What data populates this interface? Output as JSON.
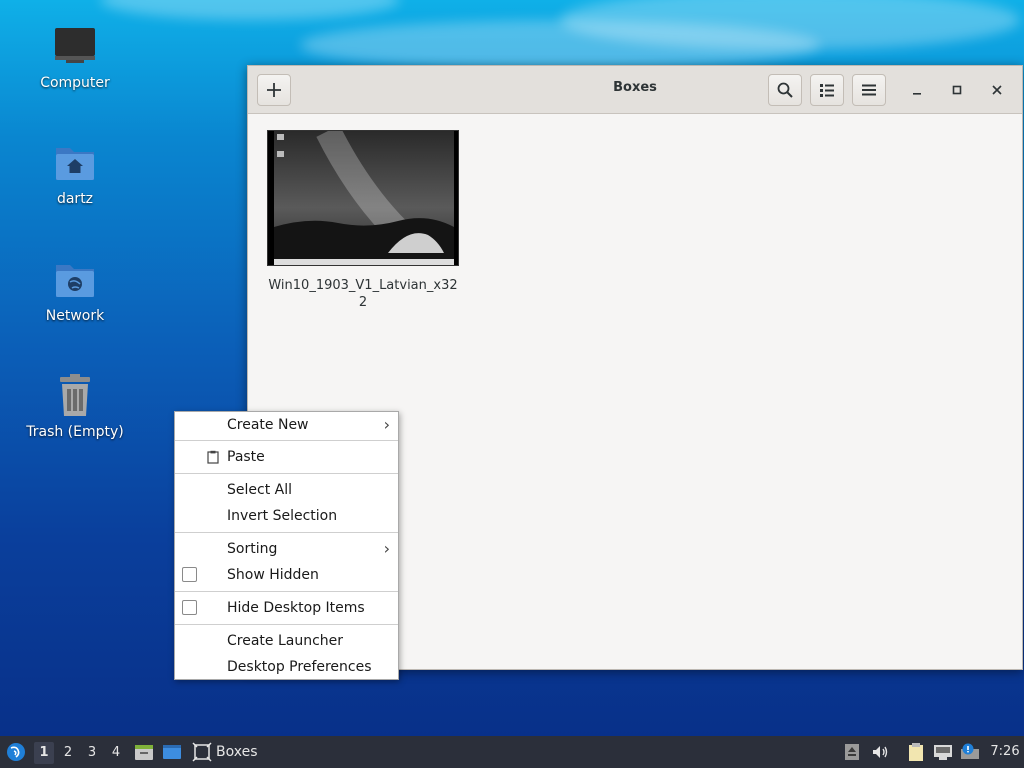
{
  "desktop": {
    "icons": [
      {
        "label": "Computer"
      },
      {
        "label": "dartz"
      },
      {
        "label": "Network"
      },
      {
        "label": "Trash (Empty)"
      }
    ]
  },
  "window": {
    "title": "Boxes",
    "vm": {
      "name": "Win10_1903_V1_Latvian_x322"
    }
  },
  "context_menu": {
    "items": [
      {
        "label": "Create New",
        "submenu": true
      },
      {
        "label": "Paste"
      },
      {
        "label": "Select All"
      },
      {
        "label": "Invert Selection"
      },
      {
        "label": "Sorting",
        "submenu": true
      },
      {
        "label": "Show Hidden",
        "checked": false
      },
      {
        "label": "Hide Desktop Items",
        "checked": false
      },
      {
        "label": "Create Launcher"
      },
      {
        "label": "Desktop Preferences"
      }
    ]
  },
  "panel": {
    "workspaces": [
      "1",
      "2",
      "3",
      "4"
    ],
    "active_workspace": "1",
    "task_label": "Boxes",
    "clock": "7:26"
  },
  "colors": {
    "panel_bg": "#2b2f3a",
    "folder_blue": "#4a90d9",
    "headerbar": "#e3e0dc"
  }
}
